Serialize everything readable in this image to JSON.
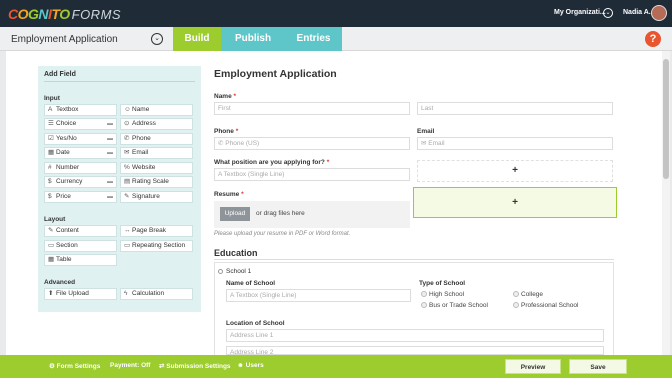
{
  "app": {
    "logo_word": "COGNITO",
    "logo_forms": "FORMS",
    "org_label": "My Organizati...",
    "user_name": "Nadia A."
  },
  "subbar": {
    "form_title": "Employment Application",
    "tabs": [
      {
        "label": "Build",
        "active": true
      },
      {
        "label": "Publish",
        "active": false
      },
      {
        "label": "Entries",
        "active": false
      }
    ],
    "help": "?"
  },
  "add_field": {
    "title": "Add Field",
    "input_heading": "Input",
    "input_fields": [
      {
        "label": "Textbox",
        "icon": "A"
      },
      {
        "label": "Name",
        "icon": "☺"
      },
      {
        "label": "Choice",
        "icon": "☰"
      },
      {
        "label": "Address",
        "icon": "⊙"
      },
      {
        "label": "Yes/No",
        "icon": "☑"
      },
      {
        "label": "Phone",
        "icon": "✆"
      },
      {
        "label": "Date",
        "icon": "▦"
      },
      {
        "label": "Email",
        "icon": "✉"
      },
      {
        "label": "Number",
        "icon": "#"
      },
      {
        "label": "Website",
        "icon": "%"
      },
      {
        "label": "Currency",
        "icon": "$"
      },
      {
        "label": "Rating Scale",
        "icon": "▤"
      },
      {
        "label": "Price",
        "icon": "$"
      },
      {
        "label": "Signature",
        "icon": "✎"
      }
    ],
    "layout_heading": "Layout",
    "layout_fields": [
      {
        "label": "Content",
        "icon": "✎"
      },
      {
        "label": "Page Break",
        "icon": "↔"
      },
      {
        "label": "Section",
        "icon": "▭"
      },
      {
        "label": "Repeating Section",
        "icon": "▭"
      },
      {
        "label": "Table",
        "icon": "▦"
      }
    ],
    "advanced_heading": "Advanced",
    "advanced_fields": [
      {
        "label": "File Upload",
        "icon": "⬆"
      },
      {
        "label": "Calculation",
        "icon": "ϟ"
      }
    ]
  },
  "form": {
    "heading": "Employment Application",
    "name_label": "Name",
    "first_placeholder": "First",
    "last_placeholder": "Last",
    "phone_label": "Phone",
    "phone_placeholder": "Phone (US)",
    "email_label": "Email",
    "email_placeholder": "Email",
    "position_label": "What position are you applying for?",
    "position_placeholder": "Textbox (Single Line)",
    "add_symbol": "+",
    "resume_label": "Resume",
    "upload_button": "Upload",
    "drag_text": "or drag files here",
    "resume_hint": "Please upload your resume in PDF or Word format.",
    "required_mark": "*",
    "education_heading": "Education",
    "school_title": "School 1",
    "school_name_label": "Name of School",
    "school_name_placeholder": "Textbox (Single Line)",
    "school_type_label": "Type of School",
    "school_types": [
      "High School",
      "College",
      "Bus  or Trade School",
      "Professional School"
    ],
    "location_label": "Location of School",
    "address_line1": "Address Line 1",
    "address_line2": "Address Line 2"
  },
  "bottom_bar": {
    "form_settings": "Form Settings",
    "payment": "Payment: Off",
    "submission_settings": "Submission Settings",
    "users": "Users",
    "preview": "Preview",
    "save": "Save"
  },
  "colors": {
    "topbar": "#1f2c38",
    "build_tab": "#9ccc2e",
    "other_tabs": "#5ec6c9",
    "help": "#e8552f",
    "add_field_panel": "#dff1f1"
  }
}
